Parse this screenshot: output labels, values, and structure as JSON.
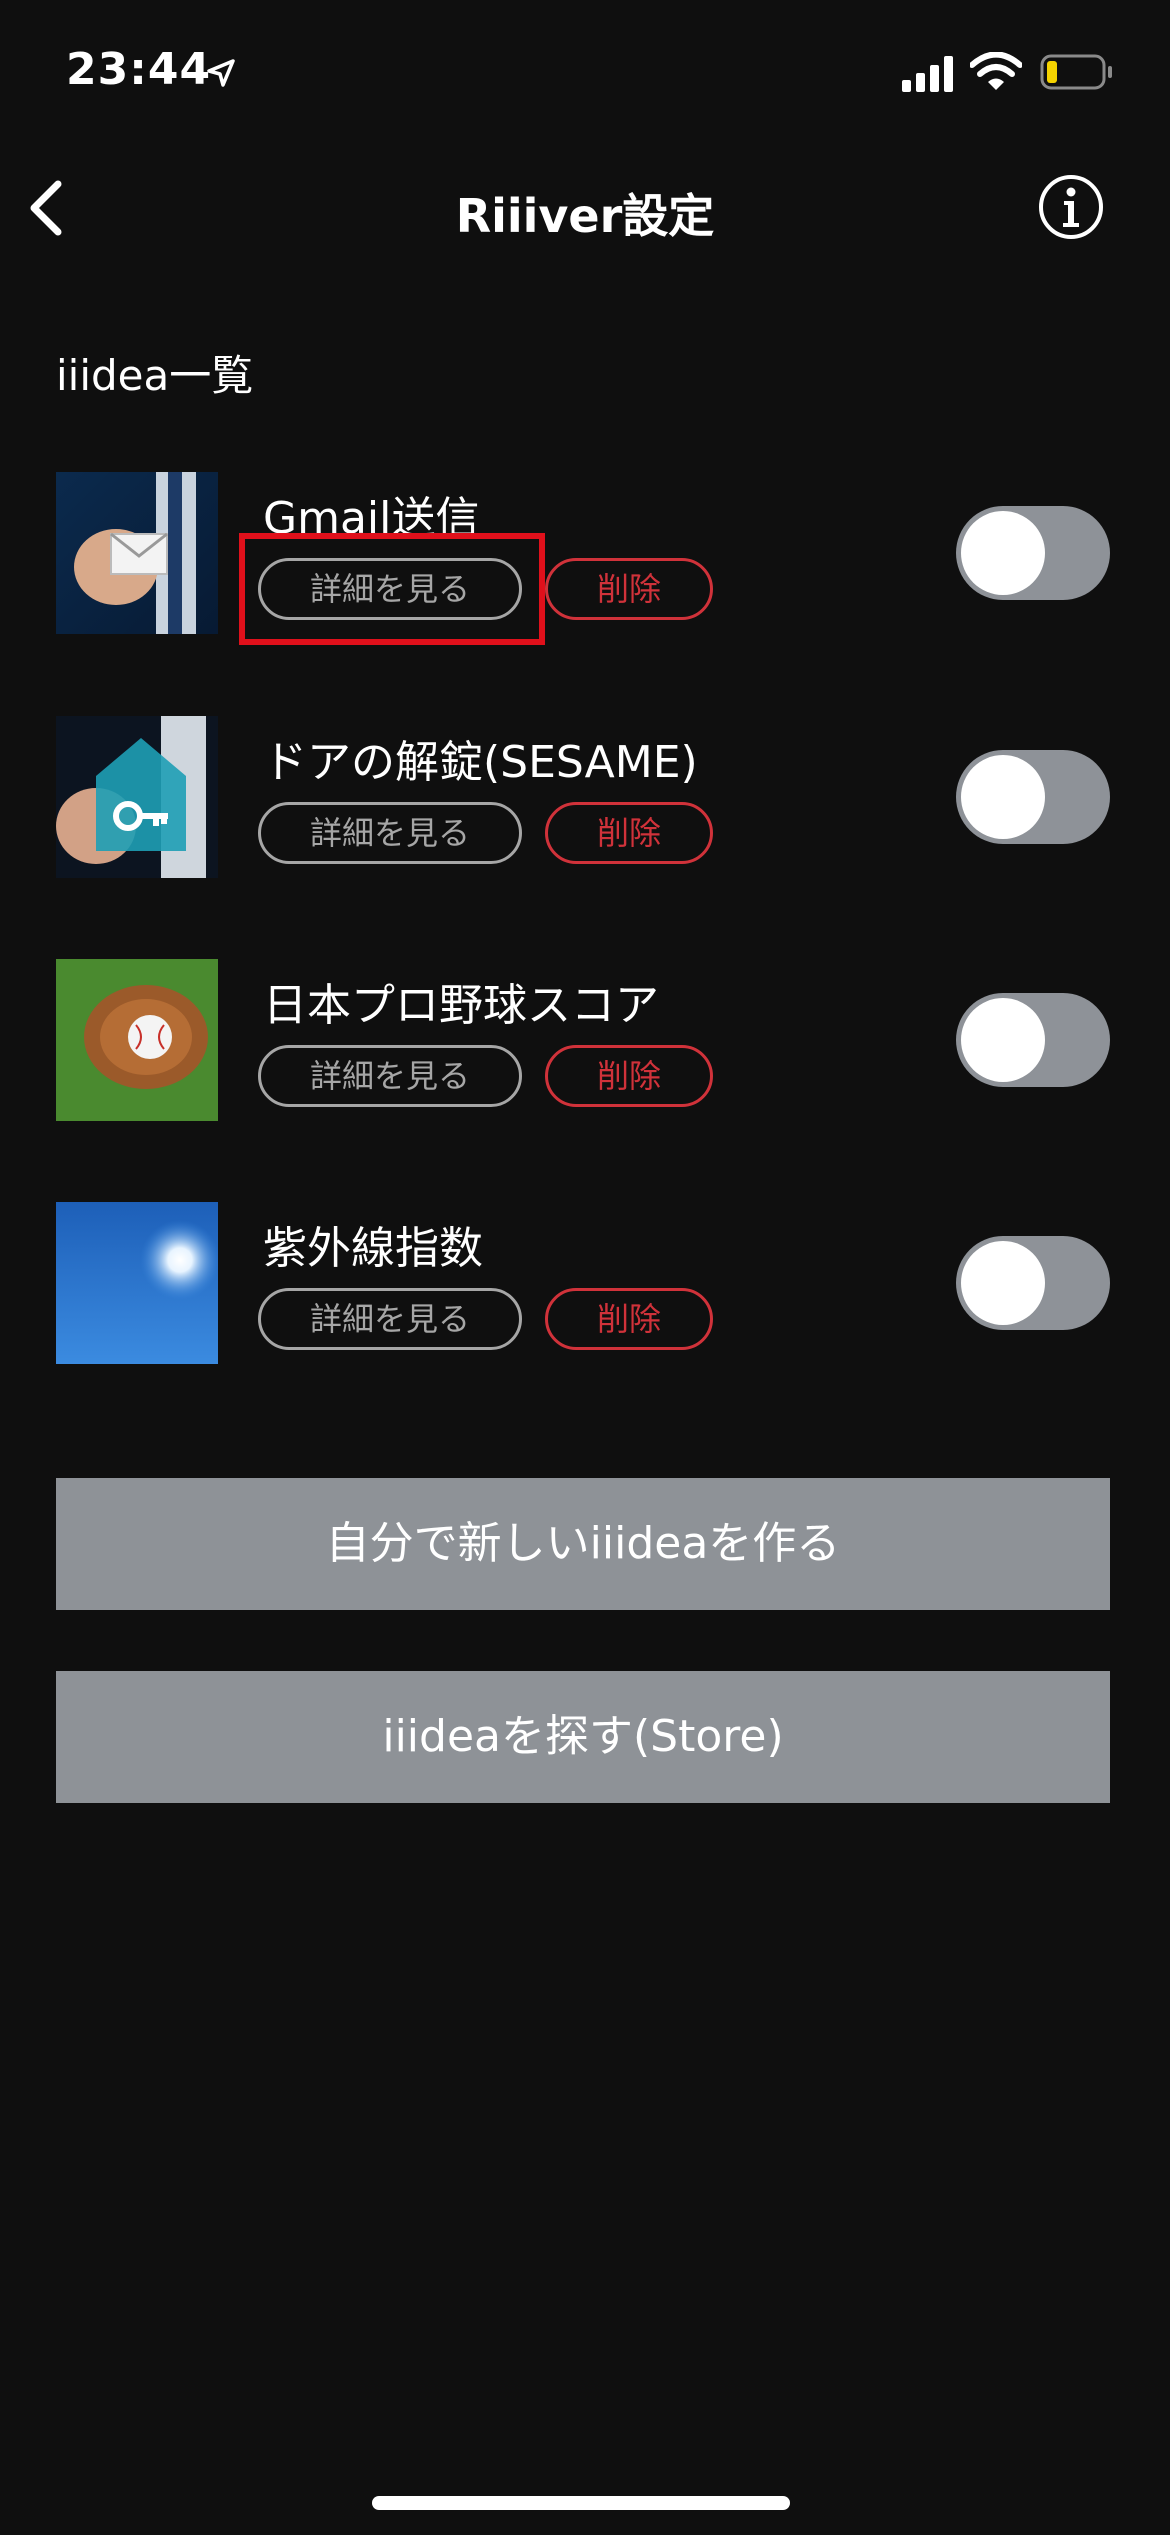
{
  "status_bar": {
    "time": "23:44",
    "battery_color": "#f5d300"
  },
  "nav": {
    "title": "Riiiver設定"
  },
  "section_title": "iiidea一覧",
  "items": [
    {
      "title": "Gmail送信",
      "detail_label": "詳細を見る",
      "delete_label": "削除",
      "enabled": false
    },
    {
      "title": "ドアの解錠(SESAME)",
      "detail_label": "詳細を見る",
      "delete_label": "削除",
      "enabled": false
    },
    {
      "title": "日本プロ野球スコア",
      "detail_label": "詳細を見る",
      "delete_label": "削除",
      "enabled": false
    },
    {
      "title": "紫外線指数",
      "detail_label": "詳細を見る",
      "delete_label": "削除",
      "enabled": false
    }
  ],
  "buttons": {
    "create": "自分で新しいiiideaを作る",
    "store": "iiideaを探す(Store)"
  },
  "colors": {
    "background": "#0f0f0f",
    "delete_red": "#d0323a",
    "highlight_red": "#e0101b",
    "toggle_off": "#8e9298",
    "button_gray": "#8e9297"
  }
}
